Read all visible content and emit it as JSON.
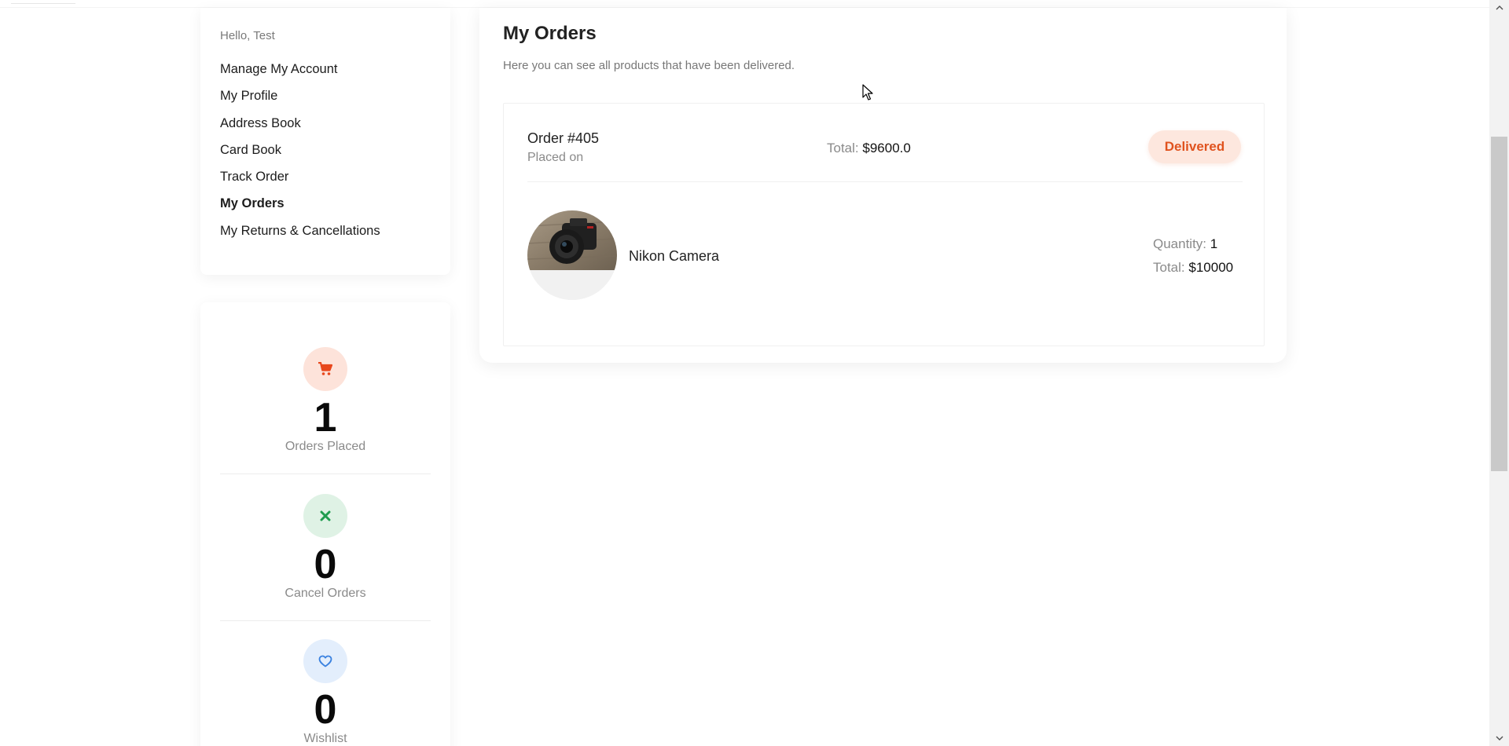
{
  "sidebar": {
    "greeting": "Hello, Test",
    "items": [
      {
        "label": "Manage My Account",
        "active": false
      },
      {
        "label": "My Profile",
        "active": false
      },
      {
        "label": "Address Book",
        "active": false
      },
      {
        "label": "Card Book",
        "active": false
      },
      {
        "label": "Track Order",
        "active": false
      },
      {
        "label": "My Orders",
        "active": true
      },
      {
        "label": "My Returns & Cancellations",
        "active": false
      }
    ]
  },
  "stats": [
    {
      "icon": "cart-icon",
      "value": "1",
      "label": "Orders Placed",
      "icon_bg": "#fde3da",
      "icon_color": "#e8471c"
    },
    {
      "icon": "close-icon",
      "value": "0",
      "label": "Cancel Orders",
      "icon_bg": "#dff2e5",
      "icon_color": "#1f9d4f"
    },
    {
      "icon": "heart-icon",
      "value": "0",
      "label": "Wishlist",
      "icon_bg": "#e3eefc",
      "icon_color": "#3b82e0"
    }
  ],
  "main": {
    "title": "My Orders",
    "subtitle": "Here you can see all products that have been delivered."
  },
  "order": {
    "number": "Order #405",
    "placed_on": "Placed on",
    "total_label": "Total:",
    "total_value": "$9600.0",
    "status": "Delivered",
    "status_color": "#e0531f",
    "product": {
      "image": "camera-photo",
      "name": "Nikon Camera",
      "quantity_label": "Quantity:",
      "quantity_value": "1",
      "total_label": "Total:",
      "total_value": "$10000"
    }
  }
}
